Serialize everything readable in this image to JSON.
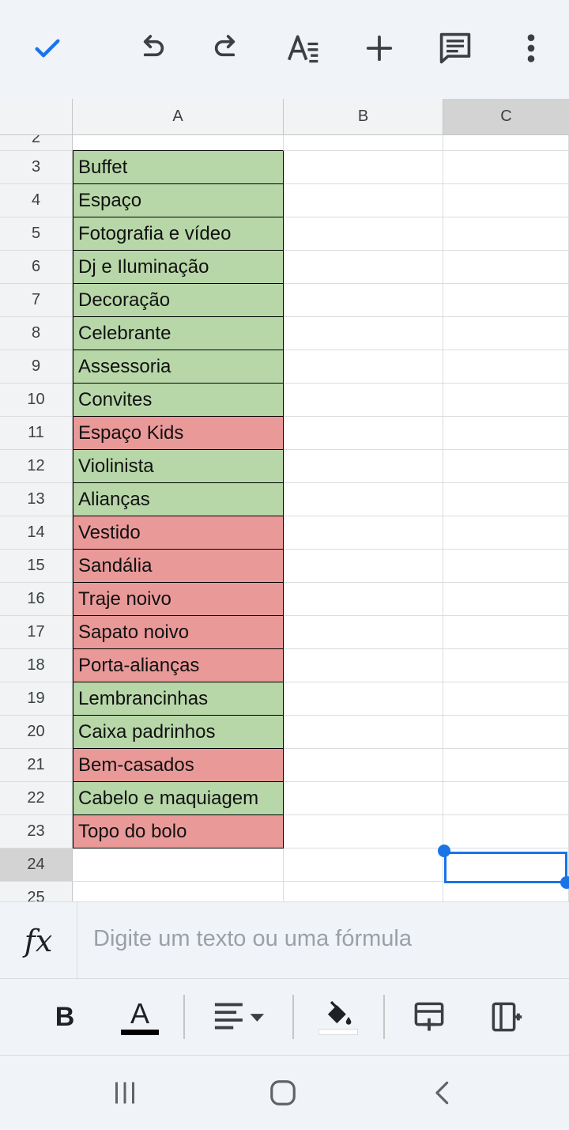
{
  "toolbar": {
    "icons": [
      "check-icon",
      "undo-icon",
      "redo-icon",
      "text-format-icon",
      "add-icon",
      "comment-icon",
      "more-vert-icon"
    ],
    "accent": "#1a73e8"
  },
  "sheet": {
    "columns": [
      "A",
      "B",
      "C"
    ],
    "selected_column": "C",
    "partial_top_row": "2",
    "rows": [
      {
        "n": "3",
        "a": "Buffet",
        "color": "green"
      },
      {
        "n": "4",
        "a": "Espaço",
        "color": "green"
      },
      {
        "n": "5",
        "a": "Fotografia e vídeo",
        "color": "green"
      },
      {
        "n": "6",
        "a": "Dj e Iluminação",
        "color": "green"
      },
      {
        "n": "7",
        "a": "Decoração",
        "color": "green"
      },
      {
        "n": "8",
        "a": "Celebrante",
        "color": "green"
      },
      {
        "n": "9",
        "a": "Assessoria",
        "color": "green"
      },
      {
        "n": "10",
        "a": "Convites",
        "color": "green"
      },
      {
        "n": "11",
        "a": "Espaço Kids",
        "color": "red"
      },
      {
        "n": "12",
        "a": "Violinista",
        "color": "green"
      },
      {
        "n": "13",
        "a": "Alianças",
        "color": "green"
      },
      {
        "n": "14",
        "a": "Vestido",
        "color": "red"
      },
      {
        "n": "15",
        "a": "Sandália",
        "color": "red"
      },
      {
        "n": "16",
        "a": "Traje noivo",
        "color": "red"
      },
      {
        "n": "17",
        "a": "Sapato noivo",
        "color": "red"
      },
      {
        "n": "18",
        "a": "Porta-alianças",
        "color": "red"
      },
      {
        "n": "19",
        "a": "Lembrancinhas",
        "color": "green"
      },
      {
        "n": "20",
        "a": "Caixa padrinhos",
        "color": "green"
      },
      {
        "n": "21",
        "a": "Bem-casados",
        "color": "red"
      },
      {
        "n": "22",
        "a": "Cabelo e maquiagem",
        "color": "green"
      },
      {
        "n": "23",
        "a": "Topo do bolo",
        "color": "red"
      },
      {
        "n": "24",
        "a": "",
        "color": "none"
      },
      {
        "n": "25",
        "a": "",
        "color": "none"
      }
    ],
    "selected_cell": "C24",
    "colors": {
      "green": "#b7d7a8",
      "red": "#ea9999"
    }
  },
  "formula_bar": {
    "fx_label": "fx",
    "placeholder": "Digite um texto ou uma fórmula"
  },
  "format_toolbar": {
    "bold_label": "B",
    "text_color_label": "A",
    "icons": [
      "bold-icon",
      "text-color-icon",
      "align-icon",
      "fill-color-icon",
      "insert-row-icon",
      "insert-column-icon"
    ]
  },
  "navbar": {
    "icons": [
      "recent-apps-icon",
      "home-icon",
      "back-icon"
    ]
  }
}
